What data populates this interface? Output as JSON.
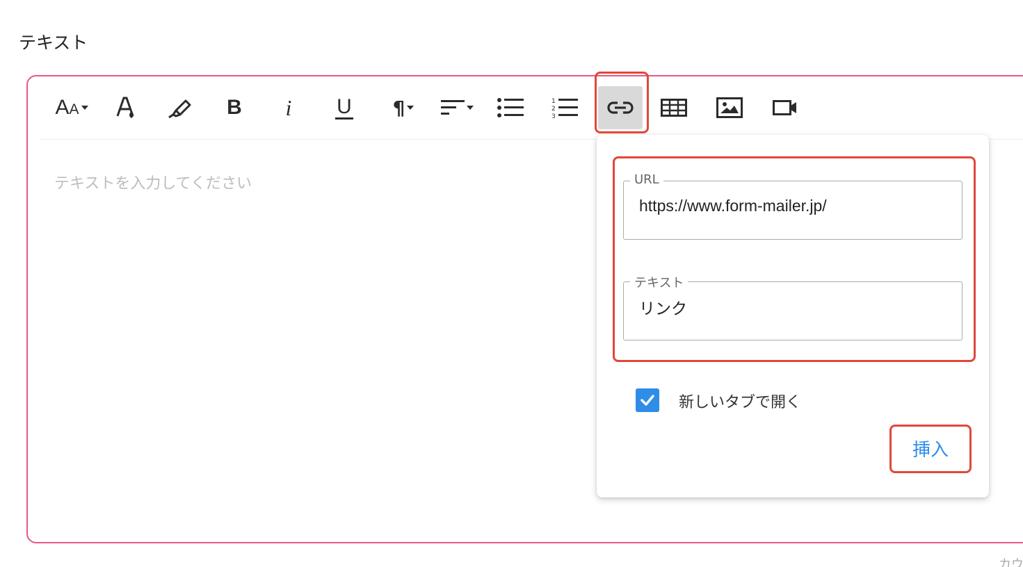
{
  "field": {
    "label": "テキスト"
  },
  "editor": {
    "placeholder": "テキストを入力してください"
  },
  "toolbar": {
    "items": [
      {
        "icon": "font-size-icon",
        "label": "Aᴀ"
      },
      {
        "icon": "font-color-icon"
      },
      {
        "icon": "highlighter-icon"
      },
      {
        "icon": "bold-icon",
        "label": "B"
      },
      {
        "icon": "italic-icon",
        "label": "i"
      },
      {
        "icon": "underline-icon",
        "label": "U"
      },
      {
        "icon": "paragraph-icon",
        "label": "¶"
      },
      {
        "icon": "align-icon"
      },
      {
        "icon": "bullet-list-icon"
      },
      {
        "icon": "numbered-list-icon"
      },
      {
        "icon": "link-icon",
        "active": true
      },
      {
        "icon": "table-icon"
      },
      {
        "icon": "image-icon"
      },
      {
        "icon": "video-icon"
      }
    ]
  },
  "link_dialog": {
    "url_label": "URL",
    "url_value": "https://www.form-mailer.jp/",
    "text_label": "テキスト",
    "text_value": "リンク",
    "new_tab_label": "新しいタブで開く",
    "new_tab_checked": true,
    "insert_label": "挿入"
  },
  "counter": {
    "text": "カウ"
  },
  "colors": {
    "editor_border": "#e8578a",
    "highlight": "#e2473a",
    "accent": "#2f8de8"
  }
}
